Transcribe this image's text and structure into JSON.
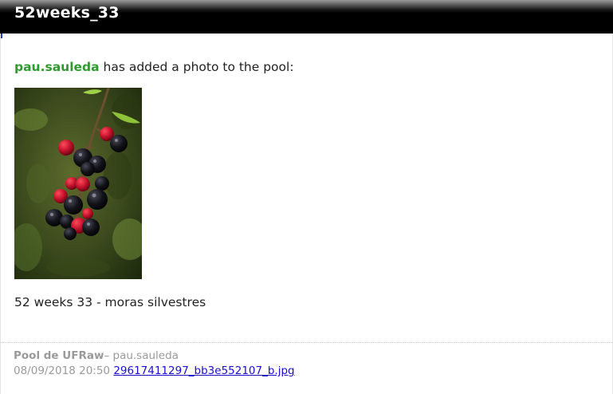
{
  "email": {
    "title": "52weeks_33",
    "notice": {
      "username": "pau.sauleda",
      "text": " has added a photo to the pool:"
    },
    "photo": {
      "subject": "blackberries-branch"
    },
    "caption": "52 weeks 33 - moras silvestres",
    "footer": {
      "pool_name": "Pool de UFRaw",
      "separator_author": "– pau.sauleda",
      "datetime": "08/09/2018 20:50",
      "filename": "29617411297_bb3e552107_b.jpg"
    }
  },
  "colors": {
    "user_link": "#2f9a2f",
    "file_link": "#1a0dcc",
    "footer_text": "#9a9a9a",
    "titlebar": "#000000"
  }
}
